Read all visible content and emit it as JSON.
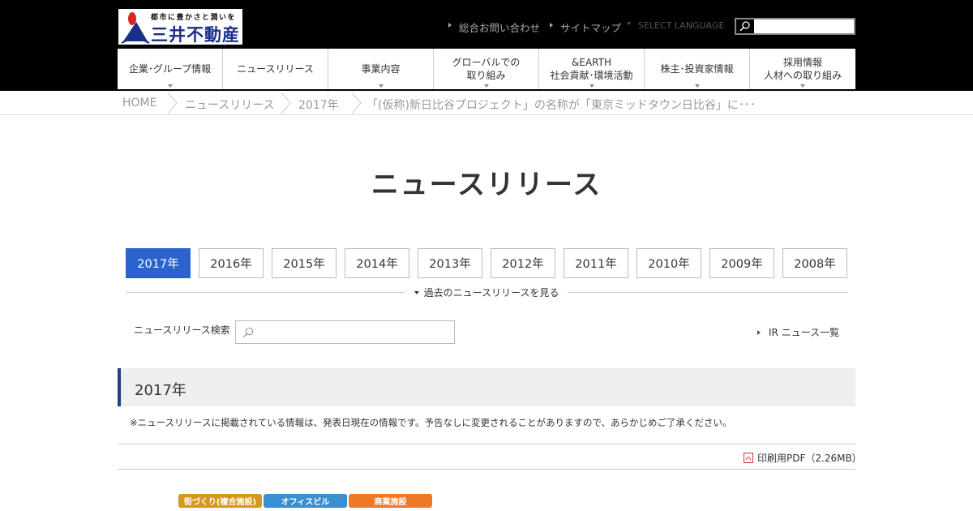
{
  "header": {
    "logo": {
      "tagline": "都市に豊かさと潤いを",
      "company_name": "三井不動産"
    },
    "utility": {
      "contact": "総合お問い合わせ",
      "sitemap": "サイトマップ",
      "language": "SELECT LANGUAGE"
    },
    "search": {
      "value": "",
      "placeholder": ""
    },
    "nav": [
      {
        "label": "企業･グループ情報"
      },
      {
        "label": "ニュースリリース"
      },
      {
        "label": "事業内容"
      },
      {
        "label": "グローバルでの\n取り組み"
      },
      {
        "label": "&EARTH\n社会貢献･環境活動"
      },
      {
        "label": "株主･投資家情報"
      },
      {
        "label": "採用情報\n人材への取り組み"
      }
    ]
  },
  "breadcrumb": [
    "HOME",
    "ニュースリリース",
    "2017年",
    "「(仮称)新日比谷プロジェクト」の名称が「東京ミッドタウン日比谷」に･･･"
  ],
  "page_title": "ニュースリリース",
  "year_tabs": [
    {
      "label": "2017年",
      "active": true
    },
    {
      "label": "2016年",
      "active": false
    },
    {
      "label": "2015年",
      "active": false
    },
    {
      "label": "2014年",
      "active": false
    },
    {
      "label": "2013年",
      "active": false
    },
    {
      "label": "2012年",
      "active": false
    },
    {
      "label": "2011年",
      "active": false
    },
    {
      "label": "2010年",
      "active": false
    },
    {
      "label": "2009年",
      "active": false
    },
    {
      "label": "2008年",
      "active": false
    }
  ],
  "past_link": "過去のニュースリリースを見る",
  "news_search": {
    "label": "ニュースリリース検索",
    "value": "",
    "placeholder": ""
  },
  "ir_link": "IR ニュース一覧",
  "section": {
    "heading": "2017年",
    "notice": "※ニュースリリースに掲載されている情報は、発表日現在の情報です。予告なしに変更されることがありますので、あらかじめご了承ください。",
    "pdf_link": "印刷用PDF（2.26MB）"
  },
  "category_tags": [
    {
      "label": "街づくり(複合施設)",
      "color": "#d49a1e"
    },
    {
      "label": "オフィスビル",
      "color": "#3a8fd1"
    },
    {
      "label": "商業施設",
      "color": "#ee7a27"
    }
  ],
  "colors": {
    "header_bg": "#000000",
    "accent_blue": "#2b63cc",
    "section_border": "#1d3e8c"
  }
}
